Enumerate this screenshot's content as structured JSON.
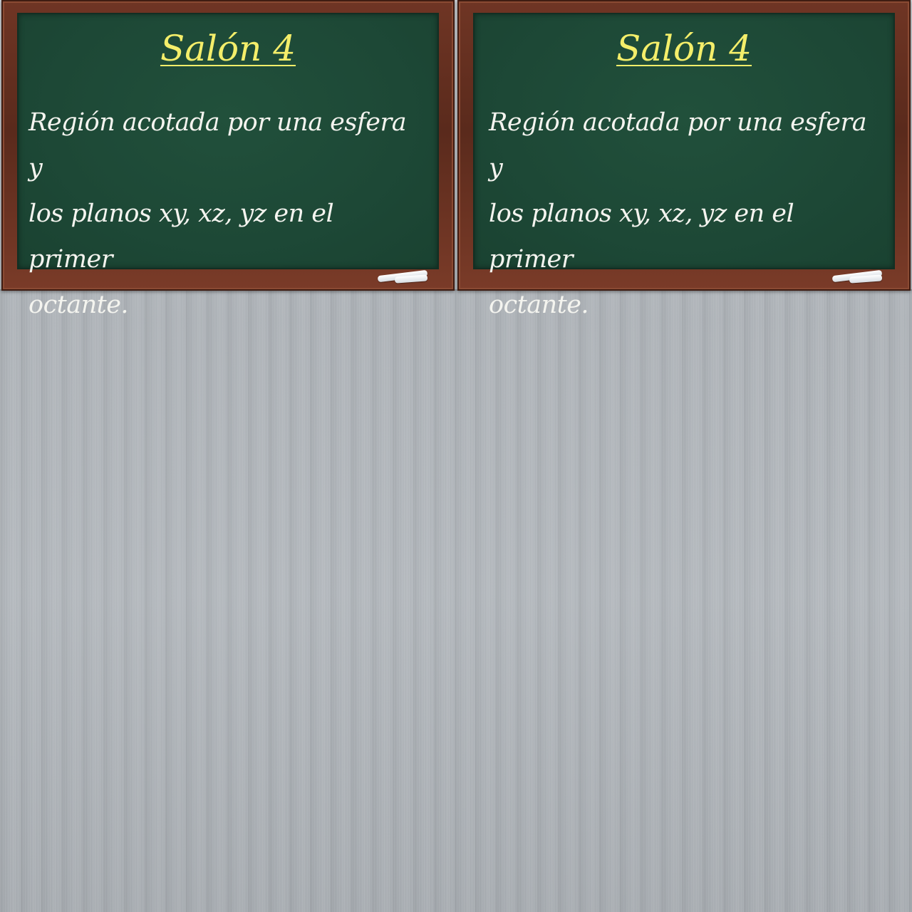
{
  "boards": [
    {
      "title": "Salón 4",
      "text_lines": [
        "Región acotada por una esfera y",
        "los planos xy, xz, yz en el primer",
        "octante."
      ]
    },
    {
      "title": "Salón 4",
      "text_lines": [
        "Región acotada por una esfera y",
        "los planos xy, xz, yz en el primer",
        "octante."
      ]
    }
  ],
  "colors": {
    "board_green": "#1d4836",
    "frame_brown": "#5a2a1c",
    "title_yellow": "#f4ee6a",
    "chalk_white": "#f4f4ef",
    "background_metal": "#b3b8bd"
  }
}
